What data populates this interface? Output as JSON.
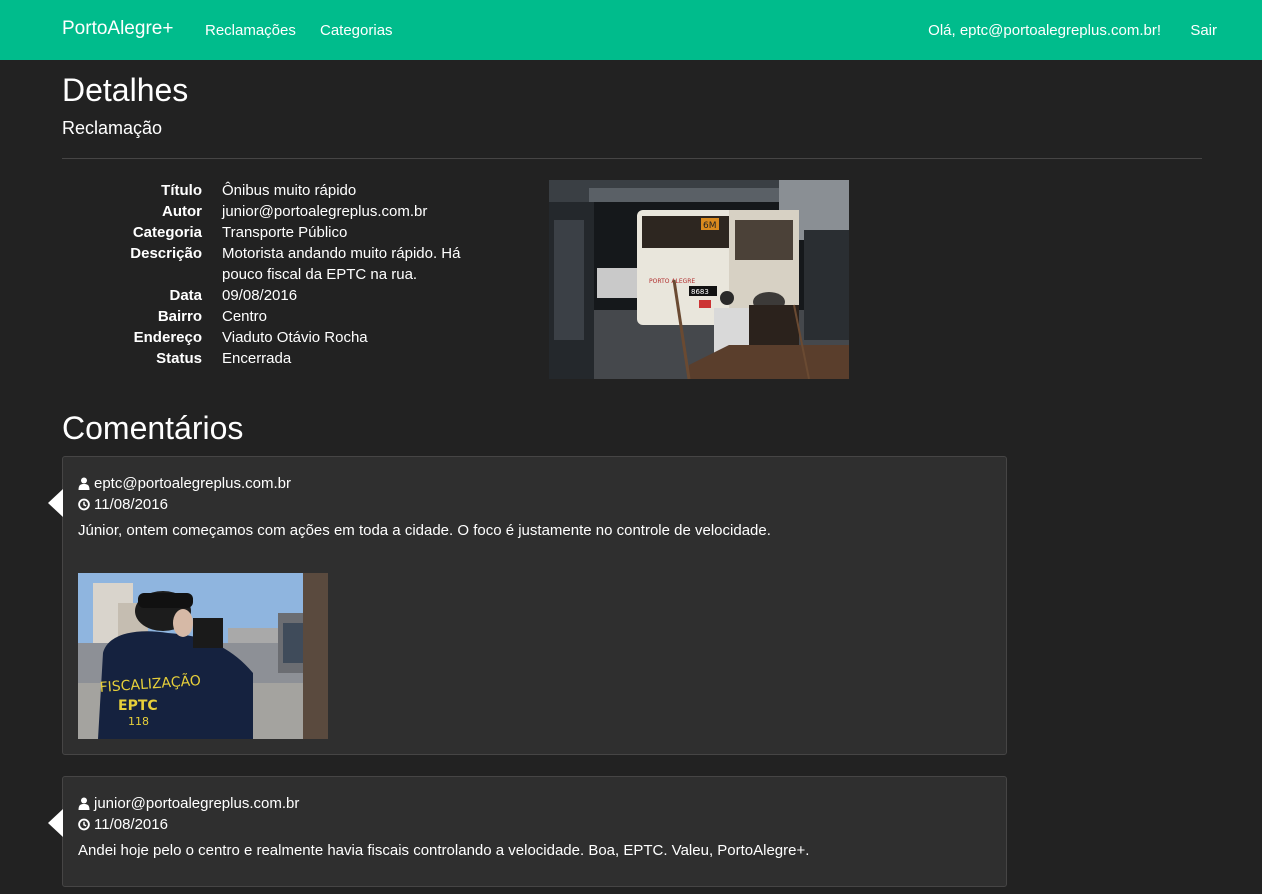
{
  "nav": {
    "brand": "PortoAlegre+",
    "links": [
      "Reclamações",
      "Categorias"
    ],
    "greeting": "Olá, eptc@portoalegreplus.com.br!",
    "logout": "Sair"
  },
  "header": {
    "title": "Detalhes",
    "subtitle": "Reclamação"
  },
  "details": [
    {
      "label": "Título",
      "value": "Ônibus muito rápido"
    },
    {
      "label": "Autor",
      "value": "junior@portoalegreplus.com.br"
    },
    {
      "label": "Categoria",
      "value": "Transporte Público"
    },
    {
      "label": "Descrição",
      "value": "Motorista andando muito rápido. Há pouco fiscal da EPTC na rua."
    },
    {
      "label": "Data",
      "value": "09/08/2016"
    },
    {
      "label": "Bairro",
      "value": "Centro"
    },
    {
      "label": "Endereço",
      "value": "Viaduto Otávio Rocha"
    },
    {
      "label": "Status",
      "value": "Encerrada"
    }
  ],
  "photo_labels": {
    "bus_sign": "PORTO ALEGRE",
    "bus_line": "6M",
    "bus_number": "8683",
    "vest_line1": "FISCALIZAÇÃO",
    "vest_line2": "EPTC",
    "vest_line3": "118"
  },
  "comments_section": {
    "title": "Comentários",
    "items": [
      {
        "author": "eptc@portoalegreplus.com.br",
        "date": "11/08/2016",
        "text": "Júnior, ontem começamos com ações em toda a cidade. O foco é justamente no controle de velocidade."
      },
      {
        "author": "junior@portoalegreplus.com.br",
        "date": "11/08/2016",
        "text": "Andei hoje pelo o centro e realmente havia fiscais controlando a velocidade. Boa, EPTC. Valeu, PortoAlegre+."
      }
    ]
  },
  "icons": {
    "author": "user-icon",
    "date": "clock-icon"
  },
  "colors": {
    "navbar": "#00bc8c",
    "background": "#222222",
    "panel": "#2f2f2f"
  }
}
